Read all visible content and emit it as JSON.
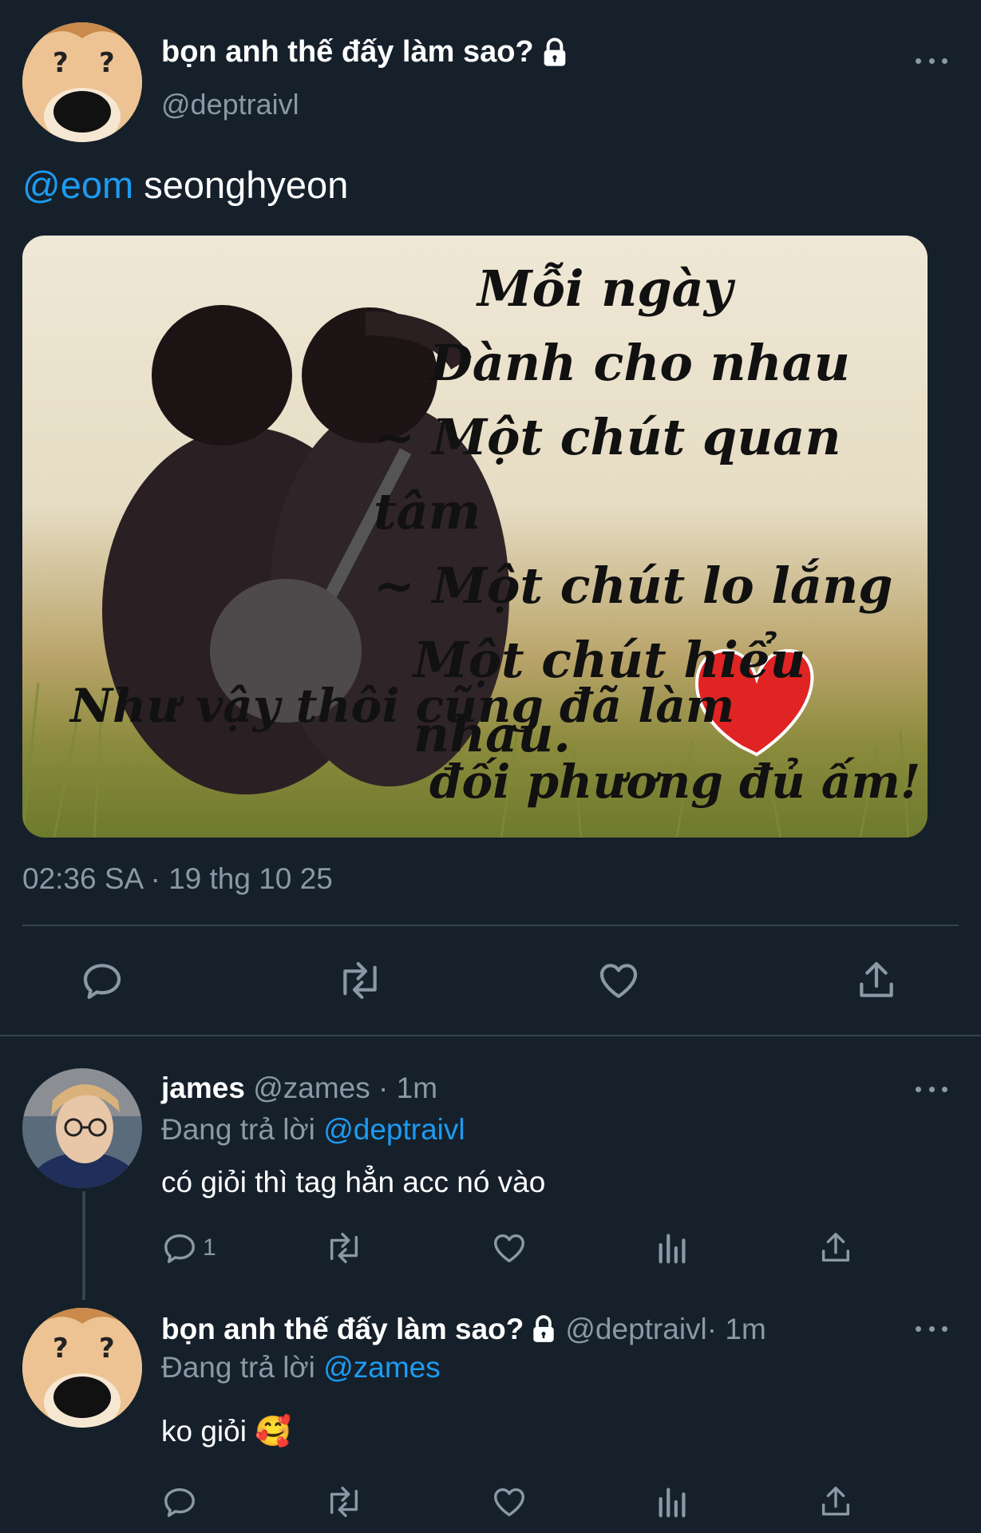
{
  "main_tweet": {
    "author_name": "bọn anh thế đấy làm sao?",
    "handle": "@deptraivl",
    "mention": "@eom",
    "text": " seonghyeon",
    "image_caption_lines": [
      "Mỗi ngày",
      "Dành cho nhau",
      "~ Một chút quan tâm",
      "~ Một chút lo lắng",
      "Một chút hiểu nhau.",
      "Như vậy thôi cũng đã làm",
      "đối phương đủ ấm!"
    ],
    "timestamp": "02:36 SA · 19 thg 10 25"
  },
  "replies": [
    {
      "author_name": "james",
      "handle": "@zames",
      "time": " · 1m",
      "replying_prefix": "Đang trả lời ",
      "replying_to": "@deptraivl",
      "text": "có giỏi thì tag hẳn acc nó vào",
      "reply_count": "1"
    },
    {
      "author_name": "bọn anh thế đấy làm sao?",
      "handle": "@deptraivl",
      "time": " · 1m",
      "replying_prefix": "Đang trả lời ",
      "replying_to": "@zames",
      "text": "ko giỏi 🥰"
    }
  ],
  "colors": {
    "background": "#15202b",
    "accent": "#1d9bf0",
    "muted": "#8b98a5",
    "divider": "#38444d"
  },
  "icons": [
    "lock-icon",
    "more-icon",
    "reply-icon",
    "retweet-icon",
    "like-icon",
    "share-icon",
    "analytics-icon"
  ]
}
